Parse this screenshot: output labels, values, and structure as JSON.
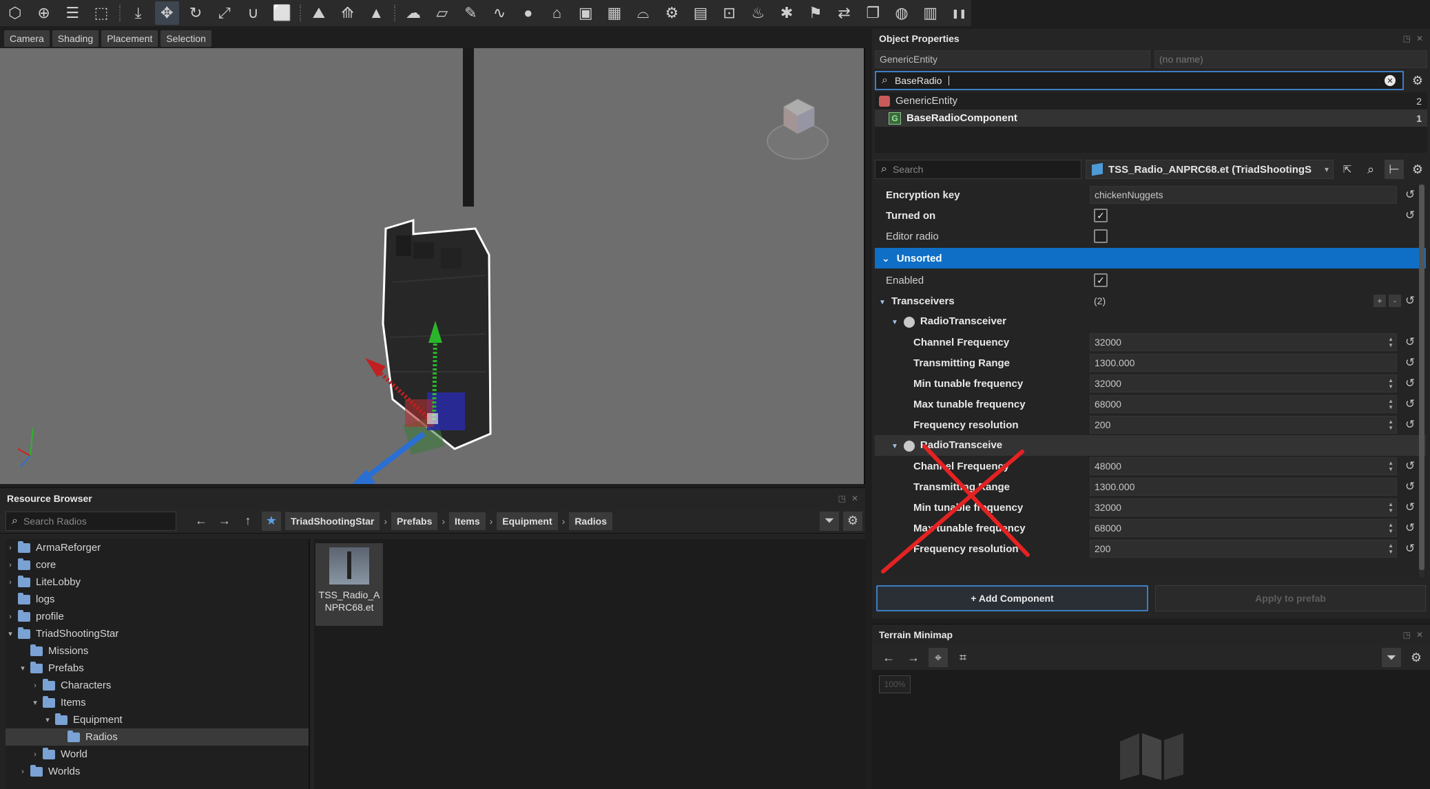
{
  "toolbar": {
    "icons": [
      "cube-icon",
      "target-icon",
      "layers-icon",
      "select-icon",
      "snap-icon",
      "move-icon",
      "rotate-icon",
      "scale-icon",
      "curve-icon",
      "marquee-icon",
      "terrain-icon",
      "road-icon",
      "spike-icon",
      "weather-icon",
      "ruler-icon",
      "brush-icon",
      "spline-icon",
      "sphere-icon",
      "house-icon",
      "box-icon",
      "blocks-icon",
      "hat-icon",
      "gears-icon",
      "map-icon",
      "frame-icon",
      "fire-icon",
      "bug-icon",
      "flag-icon",
      "swap-icon",
      "copy-icon",
      "globe-icon",
      "prefabs-icon",
      "pause-icon"
    ]
  },
  "viewport": {
    "menu": [
      "Camera",
      "Shading",
      "Placement",
      "Selection"
    ]
  },
  "resource_browser": {
    "title": "Resource Browser",
    "search_placeholder": "Search Radios",
    "breadcrumb": [
      "TriadShootingStar",
      "Prefabs",
      "Items",
      "Equipment",
      "Radios"
    ],
    "tree": [
      {
        "label": "ArmaReforger",
        "arrow": "›",
        "depth": 0
      },
      {
        "label": "core",
        "arrow": "›",
        "depth": 0
      },
      {
        "label": "LiteLobby",
        "arrow": "›",
        "depth": 0
      },
      {
        "label": "logs",
        "arrow": "",
        "depth": 0
      },
      {
        "label": "profile",
        "arrow": "›",
        "depth": 0
      },
      {
        "label": "TriadShootingStar",
        "arrow": "▾",
        "depth": 0
      },
      {
        "label": "Missions",
        "arrow": "",
        "depth": 1
      },
      {
        "label": "Prefabs",
        "arrow": "▾",
        "depth": 1
      },
      {
        "label": "Characters",
        "arrow": "›",
        "depth": 2
      },
      {
        "label": "Items",
        "arrow": "▾",
        "depth": 2
      },
      {
        "label": "Equipment",
        "arrow": "▾",
        "depth": 3
      },
      {
        "label": "Radios",
        "arrow": "",
        "depth": 4,
        "selected": true
      },
      {
        "label": "World",
        "arrow": "›",
        "depth": 2
      },
      {
        "label": "Worlds",
        "arrow": "›",
        "depth": 1
      }
    ],
    "files": [
      {
        "name": "TSS_Radio_ANPRC68.et"
      }
    ]
  },
  "object_properties": {
    "title": "Object Properties",
    "entity_class": "GenericEntity",
    "entity_name_placeholder": "(no name)",
    "filter_value": "BaseRadio",
    "hierarchy": [
      {
        "label": "GenericEntity",
        "count": "2"
      },
      {
        "label": "BaseRadioComponent",
        "count": "1",
        "icon_letter": "G"
      }
    ],
    "search_placeholder": "Search",
    "prefab": "TSS_Radio_ANPRC68.et (TriadShootingS",
    "props": {
      "encryption_key_label": "Encryption key",
      "encryption_key_value": "chickenNuggets",
      "turned_on_label": "Turned on",
      "editor_radio_label": "Editor radio",
      "section_unsorted": "Unsorted",
      "enabled_label": "Enabled",
      "transceivers_label": "Transceivers",
      "transceivers_count": "(2)",
      "transceiver_name": "RadioTransceiver",
      "transceiver_name_2": "RadioTransceive"
    },
    "transceiver_1": [
      {
        "label": "Channel Frequency",
        "value": "32000",
        "spin": true
      },
      {
        "label": "Transmitting Range",
        "value": "1300.000",
        "spin": false
      },
      {
        "label": "Min tunable frequency",
        "value": "32000",
        "spin": true
      },
      {
        "label": "Max tunable frequency",
        "value": "68000",
        "spin": true
      },
      {
        "label": "Frequency resolution",
        "value": "200",
        "spin": true
      }
    ],
    "transceiver_2": [
      {
        "label": "Channel Frequency",
        "value": "48000",
        "spin": true
      },
      {
        "label": "Transmitting Range",
        "value": "1300.000",
        "spin": false
      },
      {
        "label": "Min tunable frequency",
        "value": "32000",
        "spin": true
      },
      {
        "label": "Max tunable frequency",
        "value": "68000",
        "spin": true
      },
      {
        "label": "Frequency resolution",
        "value": "200",
        "spin": true
      }
    ],
    "add_component": "+ Add Component",
    "apply_to_prefab": "Apply to prefab"
  },
  "terrain_minimap": {
    "title": "Terrain Minimap",
    "zoom": "100%"
  },
  "colors": {
    "accent": "#0f6fc6",
    "strike": "#e52222"
  }
}
